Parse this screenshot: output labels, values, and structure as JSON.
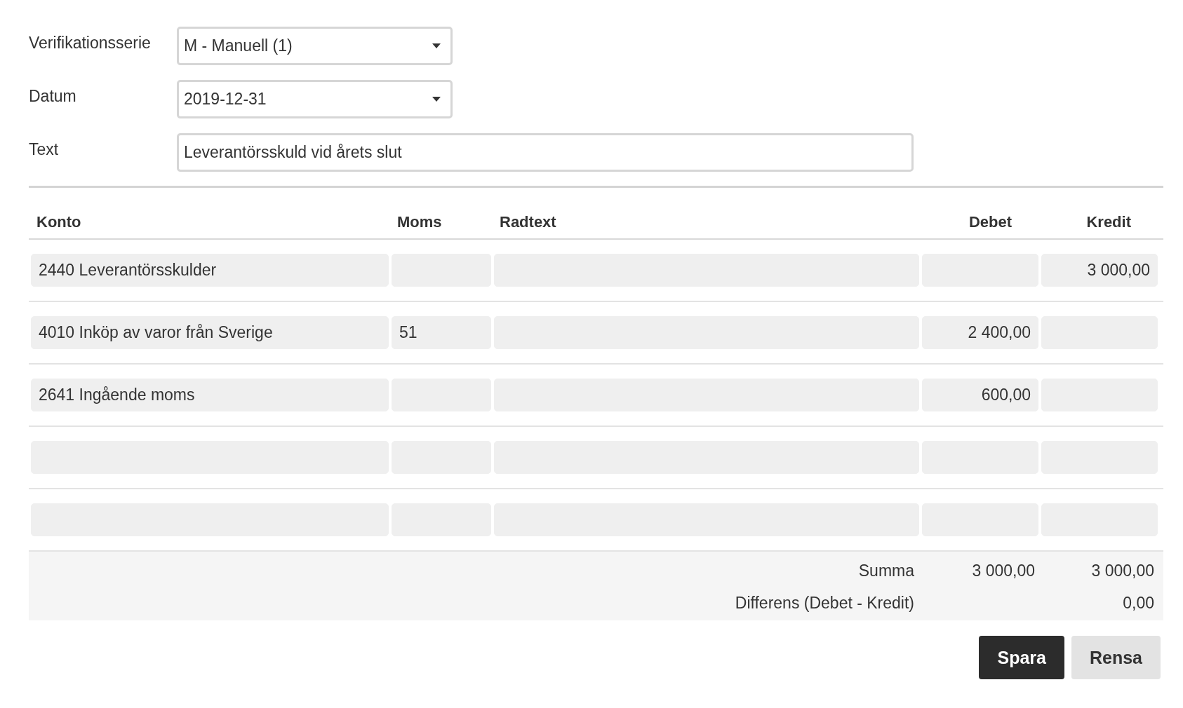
{
  "form": {
    "fields": [
      {
        "kind": "select",
        "label": "Verifikationsserie",
        "value": "M - Manuell (1)"
      },
      {
        "kind": "select",
        "label": "Datum",
        "value": "2019-12-31"
      },
      {
        "kind": "text",
        "label": "Text",
        "value": "Leverantörsskuld vid årets slut"
      }
    ]
  },
  "table": {
    "columns": [
      "Konto",
      "Moms",
      "Radtext",
      "Debet",
      "Kredit"
    ],
    "rows": [
      {
        "cells": [
          "2440 Leverantörsskulder",
          "",
          "",
          "",
          "3 000,00"
        ]
      },
      {
        "cells": [
          "4010 Inköp av varor från Sverige",
          "51",
          "",
          "2 400,00",
          ""
        ]
      },
      {
        "cells": [
          "2641 Ingående moms",
          "",
          "",
          "600,00",
          ""
        ]
      },
      {
        "cells": [
          "",
          "",
          "",
          "",
          ""
        ]
      },
      {
        "cells": [
          "",
          "",
          "",
          "",
          ""
        ]
      }
    ]
  },
  "summary": [
    {
      "label": "Summa",
      "debet": "3 000,00",
      "kredit": "3 000,00"
    },
    {
      "label": "Differens (Debet - Kredit)",
      "kredit": "0,00"
    }
  ],
  "buttons": [
    {
      "kind": "primary",
      "label": "Spara"
    },
    {
      "kind": "secondary",
      "label": "Rensa"
    }
  ]
}
